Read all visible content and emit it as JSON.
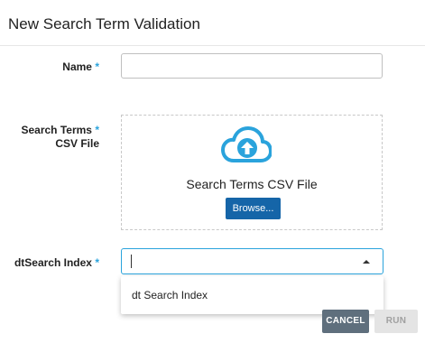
{
  "dialog": {
    "title": "New Search Term Validation"
  },
  "form": {
    "name": {
      "label": "Name",
      "required_mark": "*",
      "value": ""
    },
    "csv_file": {
      "label_line1": "Search Terms",
      "label_line2": "CSV File",
      "required_mark": "*",
      "dropzone_label": "Search Terms CSV File",
      "browse_label": "Browse...",
      "icon": "cloud-upload-icon"
    },
    "index": {
      "label": "dtSearch Index",
      "required_mark": "*",
      "value": "",
      "options": [
        "dt Search Index"
      ]
    }
  },
  "footer": {
    "cancel_label": "CANCEL",
    "run_label": "RUN"
  },
  "colors": {
    "accent": "#2aa3dc",
    "primary_button": "#1565a8",
    "cancel_button": "#5f6f7d",
    "disabled_button": "#e4e4e4"
  }
}
